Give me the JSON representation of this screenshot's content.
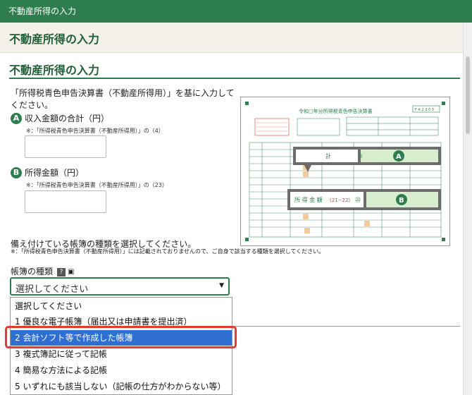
{
  "app": {
    "top_title": "不動産所得の入力",
    "page_title": "不動産所得の入力"
  },
  "section": {
    "title": "不動産所得の入力",
    "intro": "「所得税青色申告決算書（不動産所得用）」を基に入力してください。"
  },
  "fields": {
    "a": {
      "badge": "A",
      "label": "収入金額の合計（円）",
      "note": "※：「所得税青色申告決算書（不動産所得用）」の（4）",
      "value": ""
    },
    "b": {
      "badge": "B",
      "label": "所得金額（円）",
      "note": "※：「所得税青色申告決算書（不動産所得用）」の（23）",
      "value": ""
    }
  },
  "form_image": {
    "title": "令和□年分所得税青色申告決算書",
    "code": "F A 2 3 0 0",
    "callout_a_label": "計",
    "callout_a_num": "④",
    "callout_b_label": "所 得 金 額",
    "callout_b_sub": "(21−22)",
    "callout_b_num": "㉓",
    "badge_a": "A",
    "badge_b": "B"
  },
  "books": {
    "instruction": "備え付けている帳簿の種類を選択してください。",
    "note": "※：「所得税青色申告決算書（不動産所得用）」には記載されておりませんので、ご自身で該当する種類を選択してください。",
    "label": "帳簿の種類",
    "help_icon": "?",
    "selected": "選択してください",
    "options": [
      "選択してください",
      "1 優良な電子帳簿（届出又は申請書を提出済）",
      "2 会計ソフト等で作成した帳簿",
      "3 複式簿記に従って記帳",
      "4 簡易な方法による記帳",
      "5 いずれにも該当しない（記帳の仕方がわからない等）"
    ],
    "highlighted_index": 2
  },
  "colors": {
    "brand": "#2e7d4f",
    "highlight": "#2e6fd1",
    "callout_red": "#e53935"
  }
}
